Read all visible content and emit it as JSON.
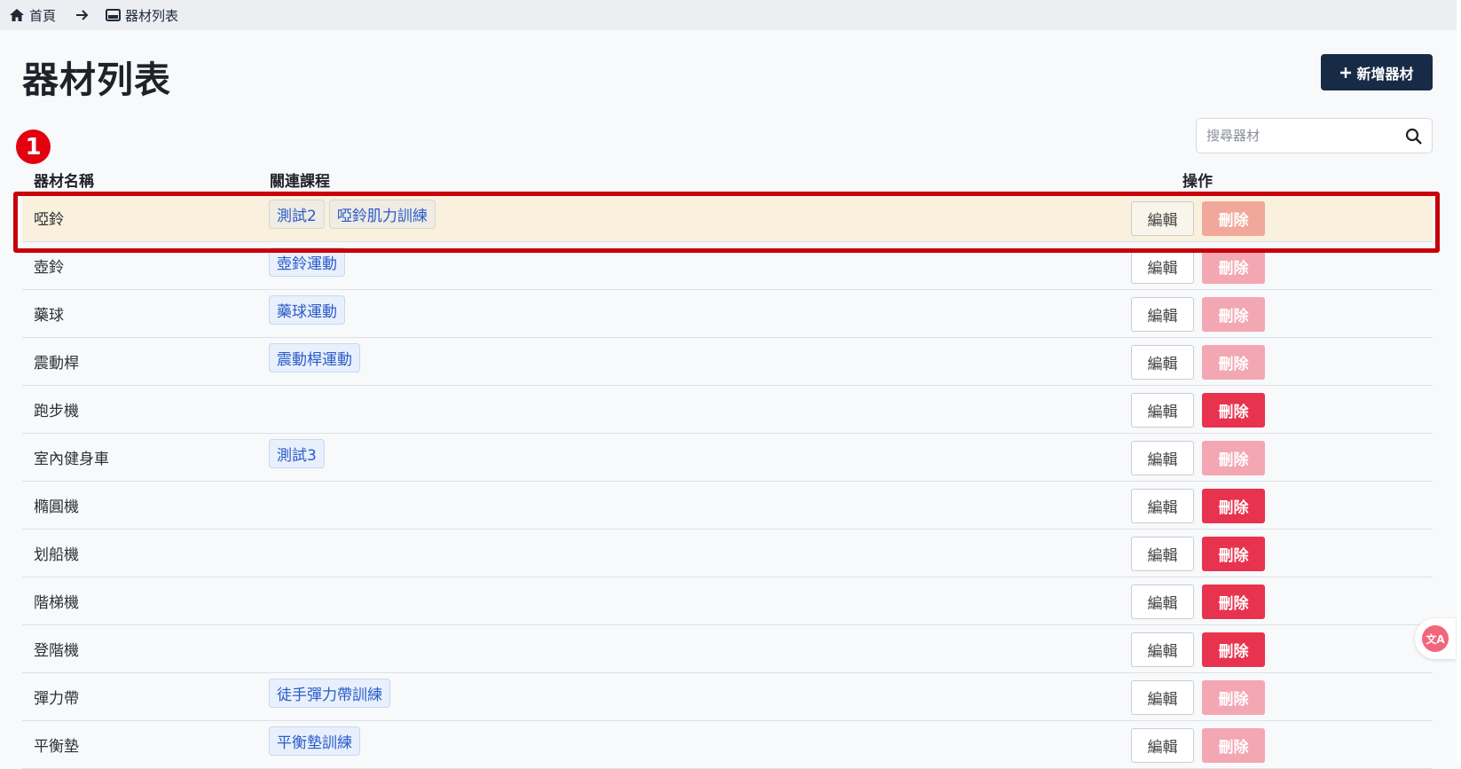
{
  "breadcrumb": {
    "home": "首頁",
    "current": "器材列表"
  },
  "page": {
    "title": "器材列表",
    "add_button": "新增器材"
  },
  "search": {
    "placeholder": "搜尋器材"
  },
  "marker": "1",
  "columns": {
    "name": "器材名稱",
    "courses": "關連課程",
    "actions": "操作"
  },
  "rows": [
    {
      "name": "啞鈴",
      "tags": [
        "測試2",
        "啞鈴肌力訓練"
      ],
      "edit": "編輯",
      "delete": "刪除",
      "delete_enabled": false,
      "highlighted": true
    },
    {
      "name": "壺鈴",
      "tags": [
        "壺鈴運動"
      ],
      "edit": "編輯",
      "delete": "刪除",
      "delete_enabled": false
    },
    {
      "name": "藥球",
      "tags": [
        "藥球運動"
      ],
      "edit": "編輯",
      "delete": "刪除",
      "delete_enabled": false
    },
    {
      "name": "震動桿",
      "tags": [
        "震動桿運動"
      ],
      "edit": "編輯",
      "delete": "刪除",
      "delete_enabled": false
    },
    {
      "name": "跑步機",
      "tags": [],
      "edit": "編輯",
      "delete": "刪除",
      "delete_enabled": true
    },
    {
      "name": "室內健身車",
      "tags": [
        "測試3"
      ],
      "edit": "編輯",
      "delete": "刪除",
      "delete_enabled": false
    },
    {
      "name": "橢圓機",
      "tags": [],
      "edit": "編輯",
      "delete": "刪除",
      "delete_enabled": true
    },
    {
      "name": "划船機",
      "tags": [],
      "edit": "編輯",
      "delete": "刪除",
      "delete_enabled": true
    },
    {
      "name": "階梯機",
      "tags": [],
      "edit": "編輯",
      "delete": "刪除",
      "delete_enabled": true
    },
    {
      "name": "登階機",
      "tags": [],
      "edit": "編輯",
      "delete": "刪除",
      "delete_enabled": true
    },
    {
      "name": "彈力帶",
      "tags": [
        "徒手彈力帶訓練"
      ],
      "edit": "編輯",
      "delete": "刪除",
      "delete_enabled": false
    },
    {
      "name": "平衡墊",
      "tags": [
        "平衡墊訓練"
      ],
      "edit": "編輯",
      "delete": "刪除",
      "delete_enabled": false
    }
  ],
  "colors": {
    "primary": "#172a46",
    "danger": "#e8334f",
    "danger_disabled": "#f3a7b3",
    "highlight_border": "#c8000a"
  },
  "icons": {
    "home": "home-icon",
    "arrow": "arrow-right-icon",
    "list": "list-icon",
    "plus": "plus-icon",
    "search": "search-icon",
    "translate": "translate-icon"
  }
}
